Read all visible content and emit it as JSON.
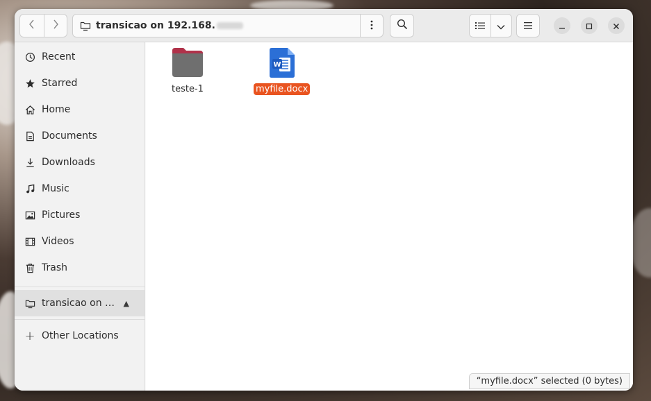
{
  "header": {
    "location_label": "transicao on 192.168.",
    "back_icon": "chevron-left-icon",
    "forward_icon": "chevron-right-icon",
    "path_menu_icon": "vertical-ellipsis-icon",
    "search_icon": "search-icon",
    "list_view_icon": "list-view-icon",
    "view_options_icon": "chevron-down-icon",
    "main_menu_icon": "hamburger-menu-icon",
    "minimize_icon": "minimize-icon",
    "maximize_icon": "maximize-icon",
    "close_icon": "close-icon"
  },
  "sidebar": {
    "items": [
      {
        "label": "Recent",
        "icon": "clock-icon"
      },
      {
        "label": "Starred",
        "icon": "star-icon"
      },
      {
        "label": "Home",
        "icon": "home-icon"
      },
      {
        "label": "Documents",
        "icon": "document-icon"
      },
      {
        "label": "Downloads",
        "icon": "download-icon"
      },
      {
        "label": "Music",
        "icon": "music-icon"
      },
      {
        "label": "Pictures",
        "icon": "picture-icon"
      },
      {
        "label": "Videos",
        "icon": "video-icon"
      },
      {
        "label": "Trash",
        "icon": "trash-icon"
      }
    ],
    "mount": {
      "label": "transicao on …",
      "icon": "network-folder-icon",
      "eject_icon": "eject-icon",
      "eject_glyph": "▲"
    },
    "other": {
      "label": "Other Locations",
      "icon": "plus-icon",
      "glyph": "+"
    }
  },
  "files": [
    {
      "name": "teste-1",
      "type": "folder",
      "selected": false
    },
    {
      "name": "myfile.docx",
      "type": "word-document",
      "selected": true
    }
  ],
  "status": {
    "text": "“myfile.docx” selected  (0 bytes)"
  },
  "colors": {
    "accent": "#e95420",
    "word_blue": "#2b6fd6",
    "folder_tab": "#b0324a",
    "folder_body": "#6f6f6f"
  }
}
